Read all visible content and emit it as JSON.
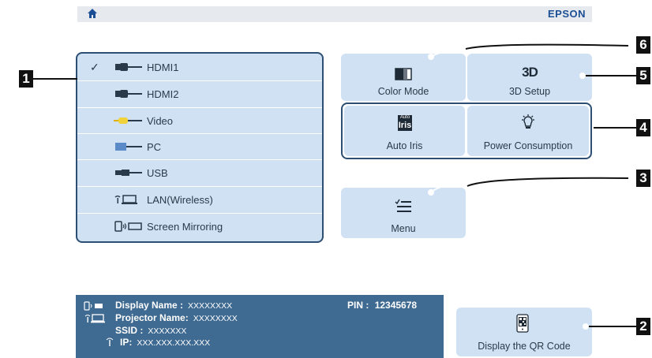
{
  "header": {
    "brand": "EPSON",
    "home_icon": "home-icon"
  },
  "sources": [
    {
      "label": "HDMI1",
      "selected": true,
      "icon": "hdmi-icon"
    },
    {
      "label": "HDMI2",
      "selected": false,
      "icon": "hdmi-icon"
    },
    {
      "label": "Video",
      "selected": false,
      "icon": "video-icon"
    },
    {
      "label": "PC",
      "selected": false,
      "icon": "pc-icon"
    },
    {
      "label": "USB",
      "selected": false,
      "icon": "usb-icon"
    },
    {
      "label": "LAN(Wireless)",
      "selected": false,
      "icon": "lan-wireless-icon"
    },
    {
      "label": "Screen Mirroring",
      "selected": false,
      "icon": "screen-mirroring-icon"
    }
  ],
  "check_mark": "✓",
  "buttons": {
    "color_mode": "Color Mode",
    "setup_3d": "3D Setup",
    "auto_iris": "Auto Iris",
    "power": "Power Consumption",
    "menu": "Menu",
    "qr": "Display the QR Code"
  },
  "icon_text": {
    "three_d": "3D",
    "auto_small": "Auto",
    "iris_big": "Iris"
  },
  "info": {
    "display_name_label": "Display Name :",
    "display_name_value": "XXXXXXXX",
    "pin_label": "PIN :",
    "pin_value": "12345678",
    "projector_name_label": "Projector Name:",
    "projector_name_value": "XXXXXXXX",
    "ssid_label": "SSID :",
    "ssid_value": "XXXXXXX",
    "ip_label": "IP:",
    "ip_value": "XXX.XXX.XXX.XXX"
  },
  "callouts": [
    "1",
    "2",
    "3",
    "4",
    "5",
    "6"
  ],
  "colors": {
    "panel": "#cfe1f3",
    "border": "#2d4f73",
    "info_bg": "#3f6a91",
    "brand": "#1b4f95"
  }
}
